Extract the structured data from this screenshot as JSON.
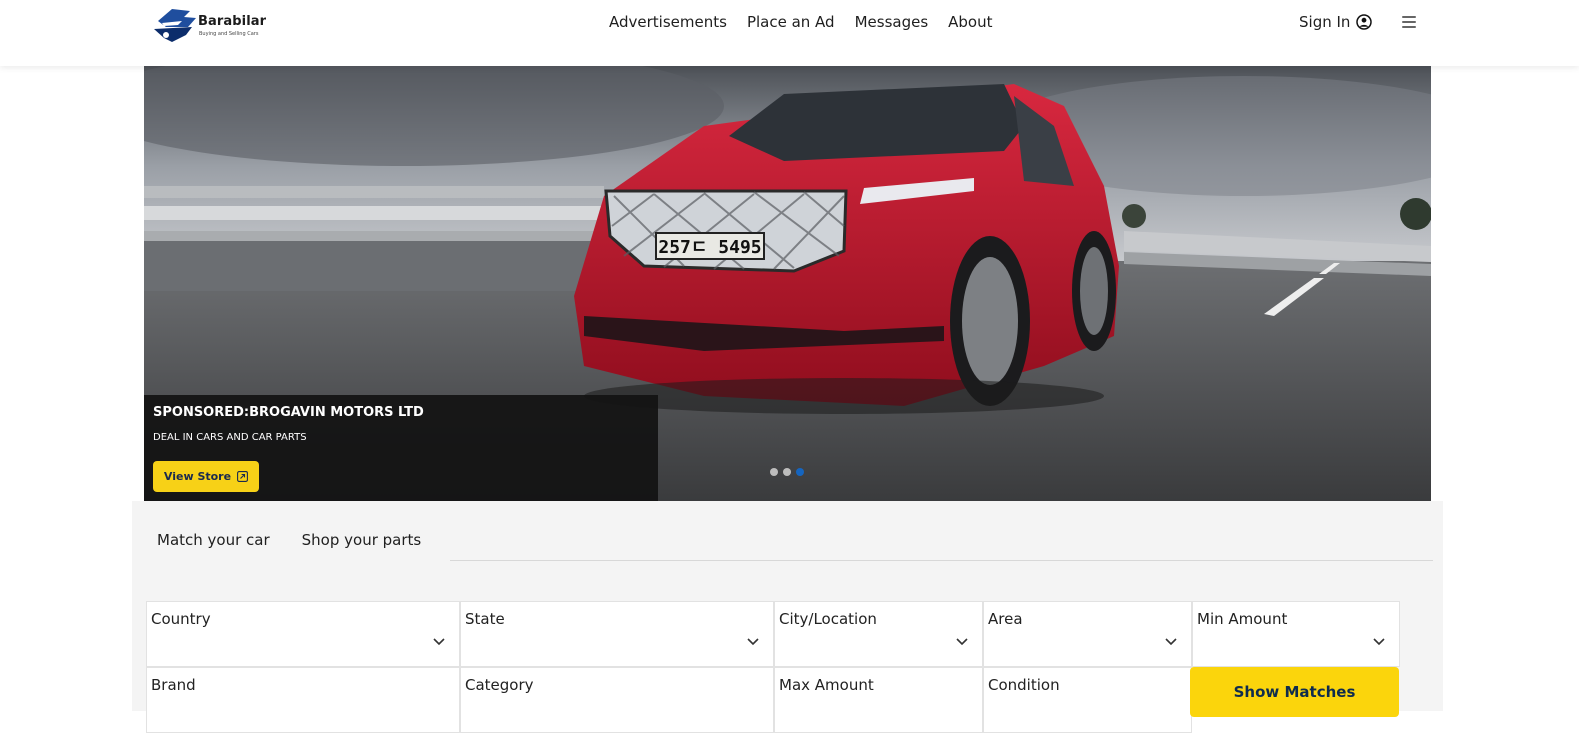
{
  "header": {
    "logo_name": "Barabilar",
    "logo_tagline": "Buying and Selling Cars",
    "nav": [
      "Advertisements",
      "Place an Ad",
      "Messages",
      "About"
    ],
    "sign_in": "Sign In"
  },
  "hero": {
    "sponsor": "SPONSORED:BROGAVIN MOTORS LTD",
    "description": "DEAL IN CARS AND CAR PARTS",
    "button": "View Store",
    "plate": "257ㄷ 5495",
    "slides": 3,
    "active_slide": 3
  },
  "search": {
    "tabs": [
      "Match your car",
      "Shop your parts"
    ],
    "fields_row1": [
      "Country",
      "State",
      "City/Location",
      "Area",
      "Min Amount"
    ],
    "fields_row2": [
      "Brand",
      "Category",
      "Max Amount",
      "Condition"
    ],
    "show_button": "Show Matches"
  },
  "colors": {
    "accent_yellow": "#f7d117",
    "dot_active": "#1565c0",
    "car_red": "#c2142b"
  }
}
